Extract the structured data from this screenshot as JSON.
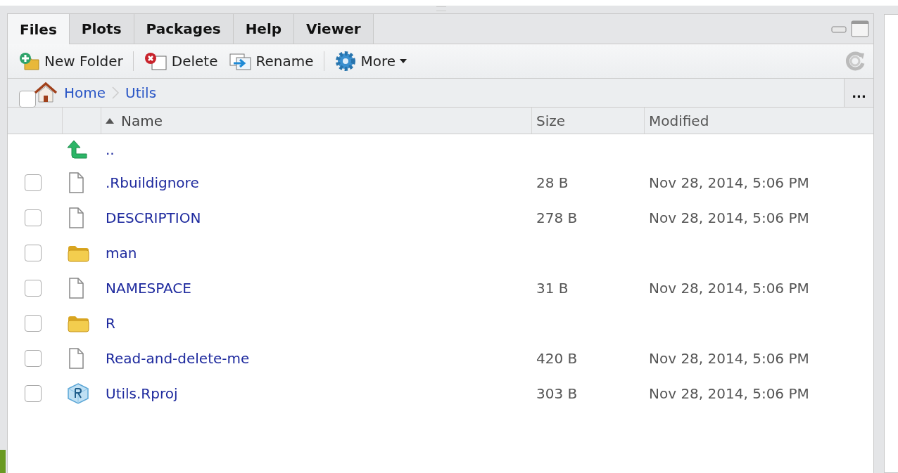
{
  "tabs": [
    {
      "label": "Files",
      "selected": true
    },
    {
      "label": "Plots",
      "selected": false
    },
    {
      "label": "Packages",
      "selected": false
    },
    {
      "label": "Help",
      "selected": false
    },
    {
      "label": "Viewer",
      "selected": false
    }
  ],
  "toolbar": [
    {
      "kind": "new-folder",
      "label": "New Folder"
    },
    {
      "kind": "delete",
      "label": "Delete"
    },
    {
      "kind": "rename",
      "label": "Rename"
    },
    {
      "kind": "more",
      "label": "More"
    }
  ],
  "breadcrumb": {
    "checked": false,
    "items": [
      "Home",
      "Utils"
    ],
    "more": "..."
  },
  "table": {
    "columns": [
      {
        "label": "Name",
        "sorted": true
      },
      {
        "label": "Size",
        "sorted": false
      },
      {
        "label": "Modified",
        "sorted": false
      }
    ],
    "rows": [
      {
        "kind": "parent",
        "name": ".."
      },
      {
        "kind": "file",
        "checked": false,
        "name": ".Rbuildignore",
        "size": "28 B",
        "modified": "Nov 28, 2014, 5:06 PM"
      },
      {
        "kind": "file",
        "checked": false,
        "name": "DESCRIPTION",
        "size": "278 B",
        "modified": "Nov 28, 2014, 5:06 PM"
      },
      {
        "kind": "folder",
        "checked": false,
        "name": "man"
      },
      {
        "kind": "file",
        "checked": false,
        "name": "NAMESPACE",
        "size": "31 B",
        "modified": "Nov 28, 2014, 5:06 PM"
      },
      {
        "kind": "folder",
        "checked": false,
        "name": "R"
      },
      {
        "kind": "file",
        "checked": false,
        "name": "Read-and-delete-me",
        "size": "420 B",
        "modified": "Nov 28, 2014, 5:06 PM"
      },
      {
        "kind": "project",
        "checked": false,
        "name": "Utils.Rproj",
        "size": "303 B",
        "modified": "Nov 28, 2014, 5:06 PM"
      }
    ]
  }
}
